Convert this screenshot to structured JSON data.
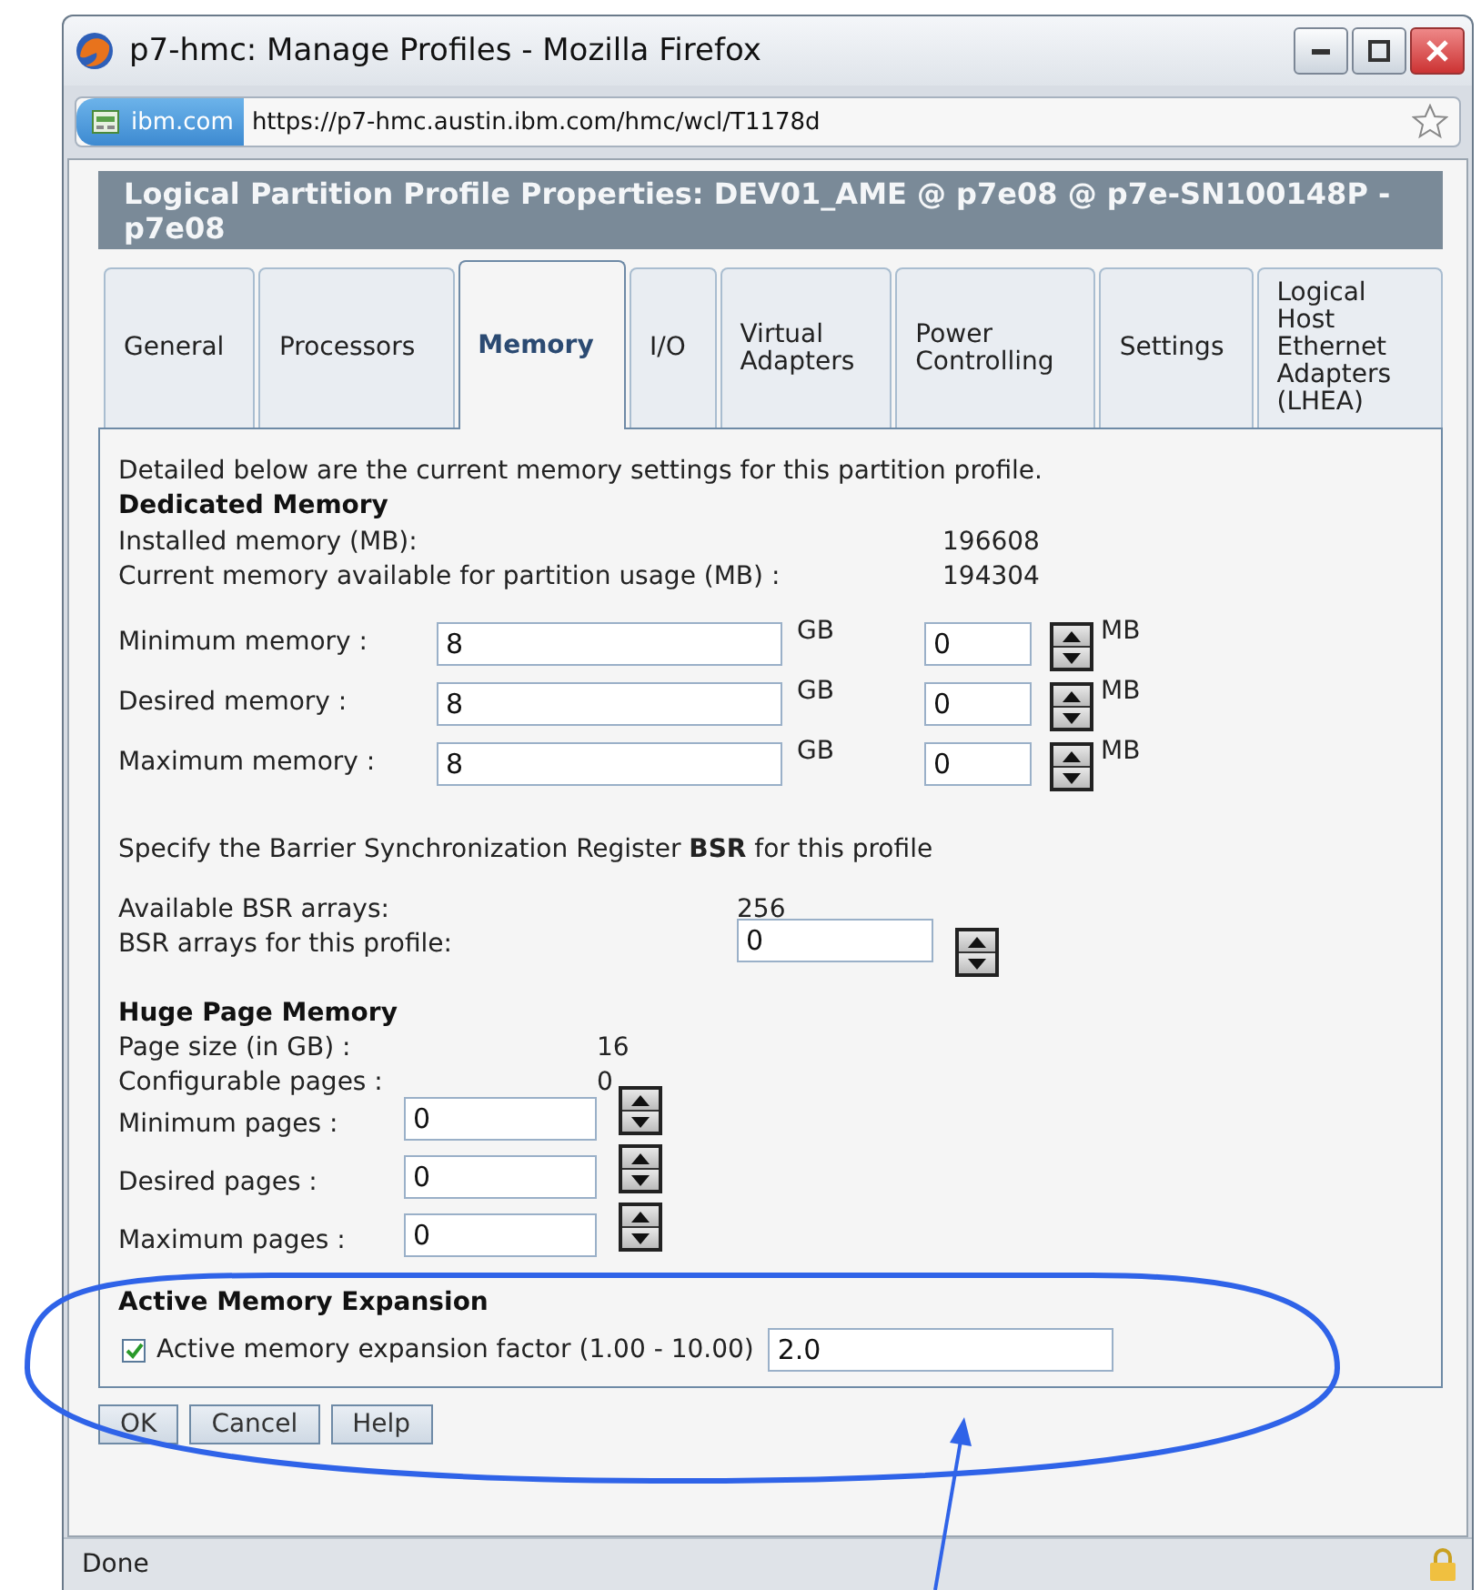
{
  "window": {
    "title": "p7-hmc: Manage Profiles - Mozilla Firefox"
  },
  "address_bar": {
    "site": "ibm.com",
    "url": "https://p7-hmc.austin.ibm.com/hmc/wcl/T1178d"
  },
  "header": "Logical Partition Profile Properties: DEV01_AME @ p7e08 @ p7e-SN100148P - p7e08",
  "tabs": [
    {
      "label": "General",
      "selected": false
    },
    {
      "label": "Processors",
      "selected": false
    },
    {
      "label": "Memory",
      "selected": true
    },
    {
      "label": "I/O",
      "selected": false
    },
    {
      "label": "Virtual Adapters",
      "selected": false
    },
    {
      "label": "Power Controlling",
      "selected": false
    },
    {
      "label": "Settings",
      "selected": false
    },
    {
      "label": "Logical Host Ethernet Adapters (LHEA)",
      "selected": false
    }
  ],
  "intro": "Detailed below are the current memory settings for this partition profile.",
  "dedicated_memory": {
    "heading": "Dedicated Memory",
    "info": [
      {
        "label": "Installed memory (MB):",
        "value": "196608"
      },
      {
        "label": "Current memory available for partition usage (MB) :",
        "value": "194304"
      }
    ],
    "rows": [
      {
        "label": "Minimum memory :",
        "gb": "8",
        "gb_unit": "GB",
        "mb": "0",
        "mb_unit": "MB"
      },
      {
        "label": "Desired memory :",
        "gb": "8",
        "gb_unit": "GB",
        "mb": "0",
        "mb_unit": "MB"
      },
      {
        "label": "Maximum memory :",
        "gb": "8",
        "gb_unit": "GB",
        "mb": "0",
        "mb_unit": "MB"
      }
    ]
  },
  "bsr": {
    "text": "Specify the Barrier Synchronization Register **BSR** for this profile",
    "available_label": "Available BSR arrays:",
    "available": "256",
    "profile_label": "BSR arrays for this profile:",
    "profile_value": "0"
  },
  "huge_pages": {
    "heading": "Huge Page Memory",
    "info": [
      {
        "label": "Page size (in GB) :",
        "value": "16"
      },
      {
        "label": "Configurable pages :",
        "value": "0"
      }
    ],
    "rows": [
      {
        "label": "Minimum pages :",
        "value": "0"
      },
      {
        "label": "Desired pages :",
        "value": "0"
      },
      {
        "label": "Maximum pages :",
        "value": "0"
      }
    ]
  },
  "ame": {
    "heading": "Active Memory Expansion",
    "label": "Active memory expansion factor (1.00 - 10.00)",
    "checked": true,
    "value": "2.0"
  },
  "buttons": [
    "OK",
    "Cancel",
    "Help"
  ],
  "status_bar": {
    "text": "Done"
  }
}
